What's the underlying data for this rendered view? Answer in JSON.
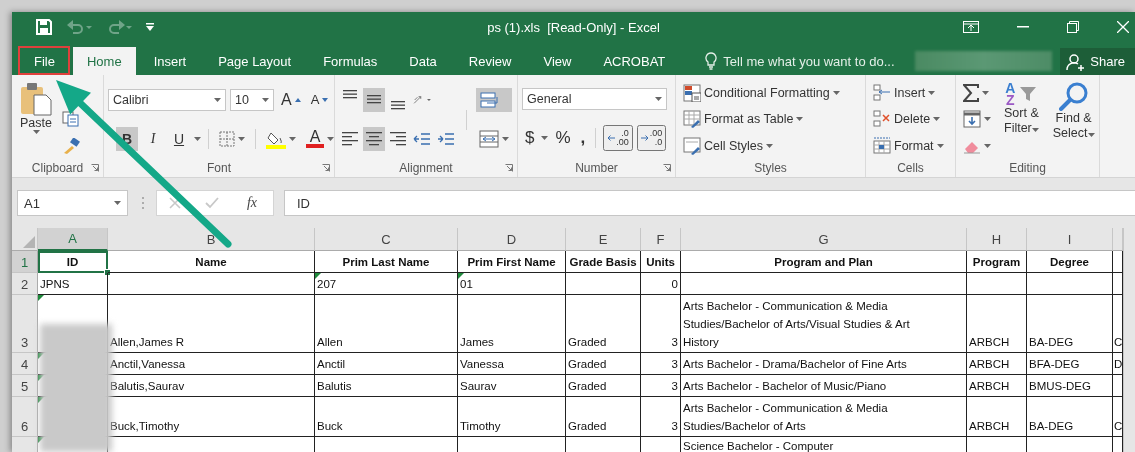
{
  "window": {
    "title": "ps (1).xls  [Read-Only] - Excel"
  },
  "quick_access": [
    {
      "kind": "save",
      "disabled": false
    },
    {
      "kind": "undo",
      "disabled": true
    },
    {
      "kind": "redo",
      "disabled": true
    },
    {
      "kind": "customize",
      "disabled": false
    }
  ],
  "tabs": [
    {
      "label": "File",
      "selected": false
    },
    {
      "label": "Home",
      "selected": true
    },
    {
      "label": "Insert",
      "selected": false
    },
    {
      "label": "Page Layout",
      "selected": false
    },
    {
      "label": "Formulas",
      "selected": false
    },
    {
      "label": "Data",
      "selected": false
    },
    {
      "label": "Review",
      "selected": false
    },
    {
      "label": "View",
      "selected": false
    },
    {
      "label": "ACROBAT",
      "selected": false
    }
  ],
  "tell_me": {
    "placeholder": "Tell me what you want to do..."
  },
  "account": {
    "blurred": true
  },
  "share": {
    "label": "Share"
  },
  "ribbon": {
    "clipboard": {
      "label": "Clipboard",
      "paste": "Paste"
    },
    "font": {
      "label": "Font",
      "font_name": "Calibri",
      "font_size": "10",
      "grow": "A",
      "shrink": "A",
      "bold": {
        "text": "B",
        "pressed": true
      },
      "italic": {
        "text": "I",
        "pressed": false
      },
      "underline": {
        "text": "U",
        "pressed": false
      },
      "font_color": "A"
    },
    "alignment": {
      "label": "Alignment",
      "wrap_text_pressed": true,
      "buttons": [
        {
          "kind": "top",
          "pressed": false
        },
        {
          "kind": "middle",
          "pressed": true
        },
        {
          "kind": "bottom",
          "pressed": false
        },
        {
          "kind": "left",
          "pressed": false
        },
        {
          "kind": "center",
          "pressed": true
        },
        {
          "kind": "right",
          "pressed": false
        }
      ]
    },
    "number": {
      "label": "Number",
      "format": "General",
      "currency": "$",
      "percent": "%",
      "comma": ",",
      "decimals": [
        {
          "top": ".0",
          "bottom": ".00"
        },
        {
          "top": ".00",
          "bottom": ".0"
        }
      ]
    },
    "styles": {
      "label": "Styles",
      "items": [
        "Conditional Formatting",
        "Format as Table",
        "Cell Styles"
      ]
    },
    "cells": {
      "label": "Cells",
      "items": [
        "Insert",
        "Delete",
        "Format"
      ]
    },
    "editing": {
      "label": "Editing",
      "sort_letters": [
        "A",
        "Z"
      ],
      "sort": [
        "Sort &",
        "Filter"
      ],
      "find": [
        "Find &",
        "Select"
      ]
    }
  },
  "formula_bar": {
    "name_box": "A1",
    "function_label": "fx",
    "value": "ID"
  },
  "sheet": {
    "columns": [
      {
        "letter": "A",
        "selected": true,
        "numeric": false
      },
      {
        "letter": "B",
        "selected": false,
        "numeric": false
      },
      {
        "letter": "C",
        "selected": false,
        "numeric": false
      },
      {
        "letter": "D",
        "selected": false,
        "numeric": false
      },
      {
        "letter": "E",
        "selected": false,
        "numeric": false
      },
      {
        "letter": "F",
        "selected": false,
        "numeric": true
      },
      {
        "letter": "G",
        "selected": false,
        "numeric": false
      },
      {
        "letter": "H",
        "selected": false,
        "numeric": false
      },
      {
        "letter": "I",
        "selected": false,
        "numeric": false
      },
      {
        "selected": false,
        "numeric": false
      }
    ],
    "rows": [
      {
        "number": "1",
        "selected": true,
        "kind": "header",
        "cells": [
          "ID",
          "Name",
          "Prim Last Name",
          "Prim First Name",
          "Grade Basis",
          "Units",
          "Program and Plan",
          "Program",
          "Degree",
          null
        ]
      },
      {
        "number": "2",
        "selected": false,
        "kind": "data",
        "cells": [
          "JPNS",
          null,
          {
            "text": "207",
            "flagged": true
          },
          {
            "text": "01",
            "flagged": true
          },
          null,
          "0",
          null,
          null,
          null,
          null
        ]
      },
      {
        "number": "3",
        "selected": false,
        "kind": "data",
        "cells": [
          {
            "flagged": true
          },
          "Allen,James R",
          "Allen",
          "James",
          "Graded",
          "3",
          [
            "Arts Bachelor - Communication & Media",
            "Studies/Bachelor of Arts/Visual Studies & Art",
            "History"
          ],
          "ARBCH",
          "BA-DEG",
          "C"
        ]
      },
      {
        "number": "4",
        "selected": false,
        "kind": "data",
        "cells": [
          {
            "flagged": true
          },
          "Anctil,Vanessa",
          "Anctil",
          "Vanessa",
          "Graded",
          "3",
          "Arts Bachelor - Drama/Bachelor of Fine Arts",
          "ARBCH",
          "BFA-DEG",
          "D"
        ]
      },
      {
        "number": "5",
        "selected": false,
        "kind": "data",
        "cells": [
          {
            "flagged": true
          },
          "Balutis,Saurav",
          "Balutis",
          "Saurav",
          "Graded",
          "3",
          "Arts Bachelor - Bachelor of Music/Piano",
          "ARBCH",
          "BMUS-DEG",
          null
        ]
      },
      {
        "number": "6",
        "selected": false,
        "kind": "data",
        "cells": [
          {
            "flagged": true
          },
          "Buck,Timothy",
          "Buck",
          "Timothy",
          "Graded",
          "3",
          [
            "Arts Bachelor - Communication & Media",
            "Studies/Bachelor of Arts"
          ],
          "ARBCH",
          "BA-DEG",
          "C"
        ]
      },
      {
        "selected": false,
        "kind": "data",
        "cells": [
          {
            "flagged": true
          },
          null,
          null,
          null,
          null,
          null,
          "Science Bachelor - Computer",
          null,
          null,
          null
        ]
      }
    ]
  },
  "annotations": [
    {
      "kind": "highlight-box"
    },
    {
      "kind": "arrow"
    },
    {
      "kind": "blur"
    }
  ]
}
